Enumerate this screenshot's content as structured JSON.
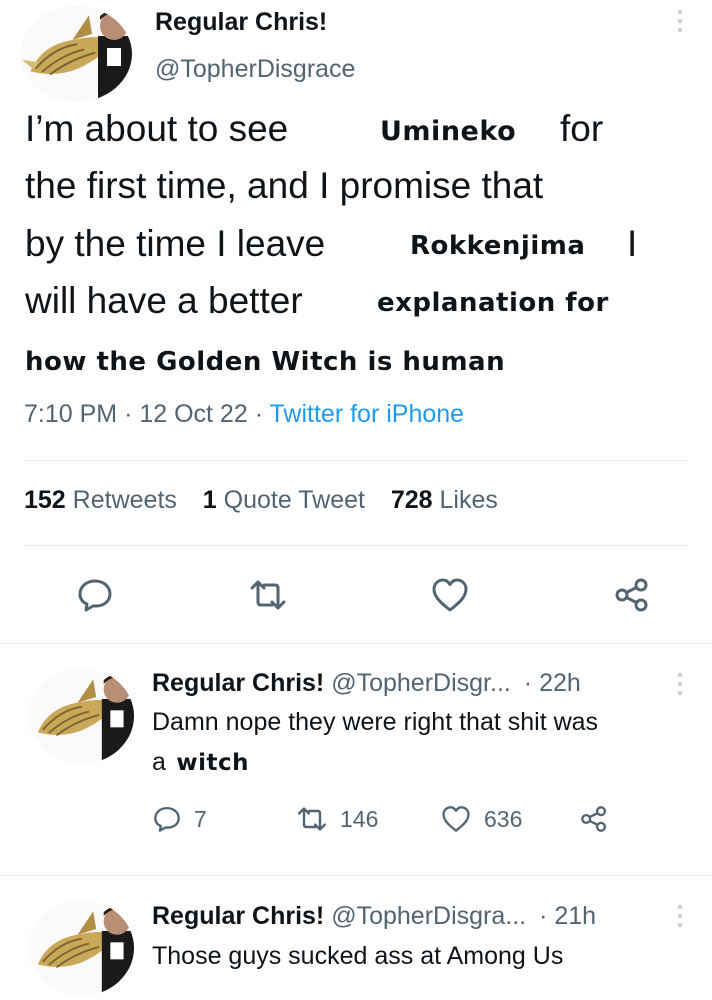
{
  "main_tweet": {
    "display_name": "Regular Chris!",
    "handle": "@TopherDisgrace",
    "text_lines": [
      {
        "plain": "I’m about to see",
        "meme": "Umineko",
        "tail": "for"
      },
      {
        "plain": "the first time, and I promise that"
      },
      {
        "plain": "by the time I leave",
        "meme": "Rokkenjima",
        "tail": "I"
      },
      {
        "plain": "will have a better",
        "meme": "explanation for"
      },
      {
        "meme": "how the Golden Witch is human"
      }
    ],
    "time": "7:10 PM",
    "date": "12 Oct 22",
    "source": "Twitter for iPhone",
    "sep": "·",
    "stats": {
      "retweets_count": "152",
      "retweets_label": "Retweets",
      "quotes_count": "1",
      "quotes_label": "Quote Tweet",
      "likes_count": "728",
      "likes_label": "Likes"
    }
  },
  "replies": [
    {
      "display_name": "Regular Chris!",
      "handle": "@TopherDisgr...",
      "age": "· 22h",
      "text_line1": "Damn nope they were right that shit was",
      "text_line2_plain": "a",
      "text_line2_meme": "witch",
      "reply_count": "7",
      "retweet_count": "146",
      "like_count": "636"
    },
    {
      "display_name": "Regular Chris!",
      "handle": "@TopherDisgra...",
      "age": "· 21h",
      "text_line1": "Those guys sucked ass at Among Us"
    }
  ],
  "colors": {
    "text": "#0f1419",
    "muted": "#536471",
    "link": "#1d9bf0",
    "divider": "#e6ecf0"
  },
  "icons": [
    "kebab-icon",
    "reply-icon",
    "retweet-icon",
    "like-icon",
    "share-icon"
  ]
}
